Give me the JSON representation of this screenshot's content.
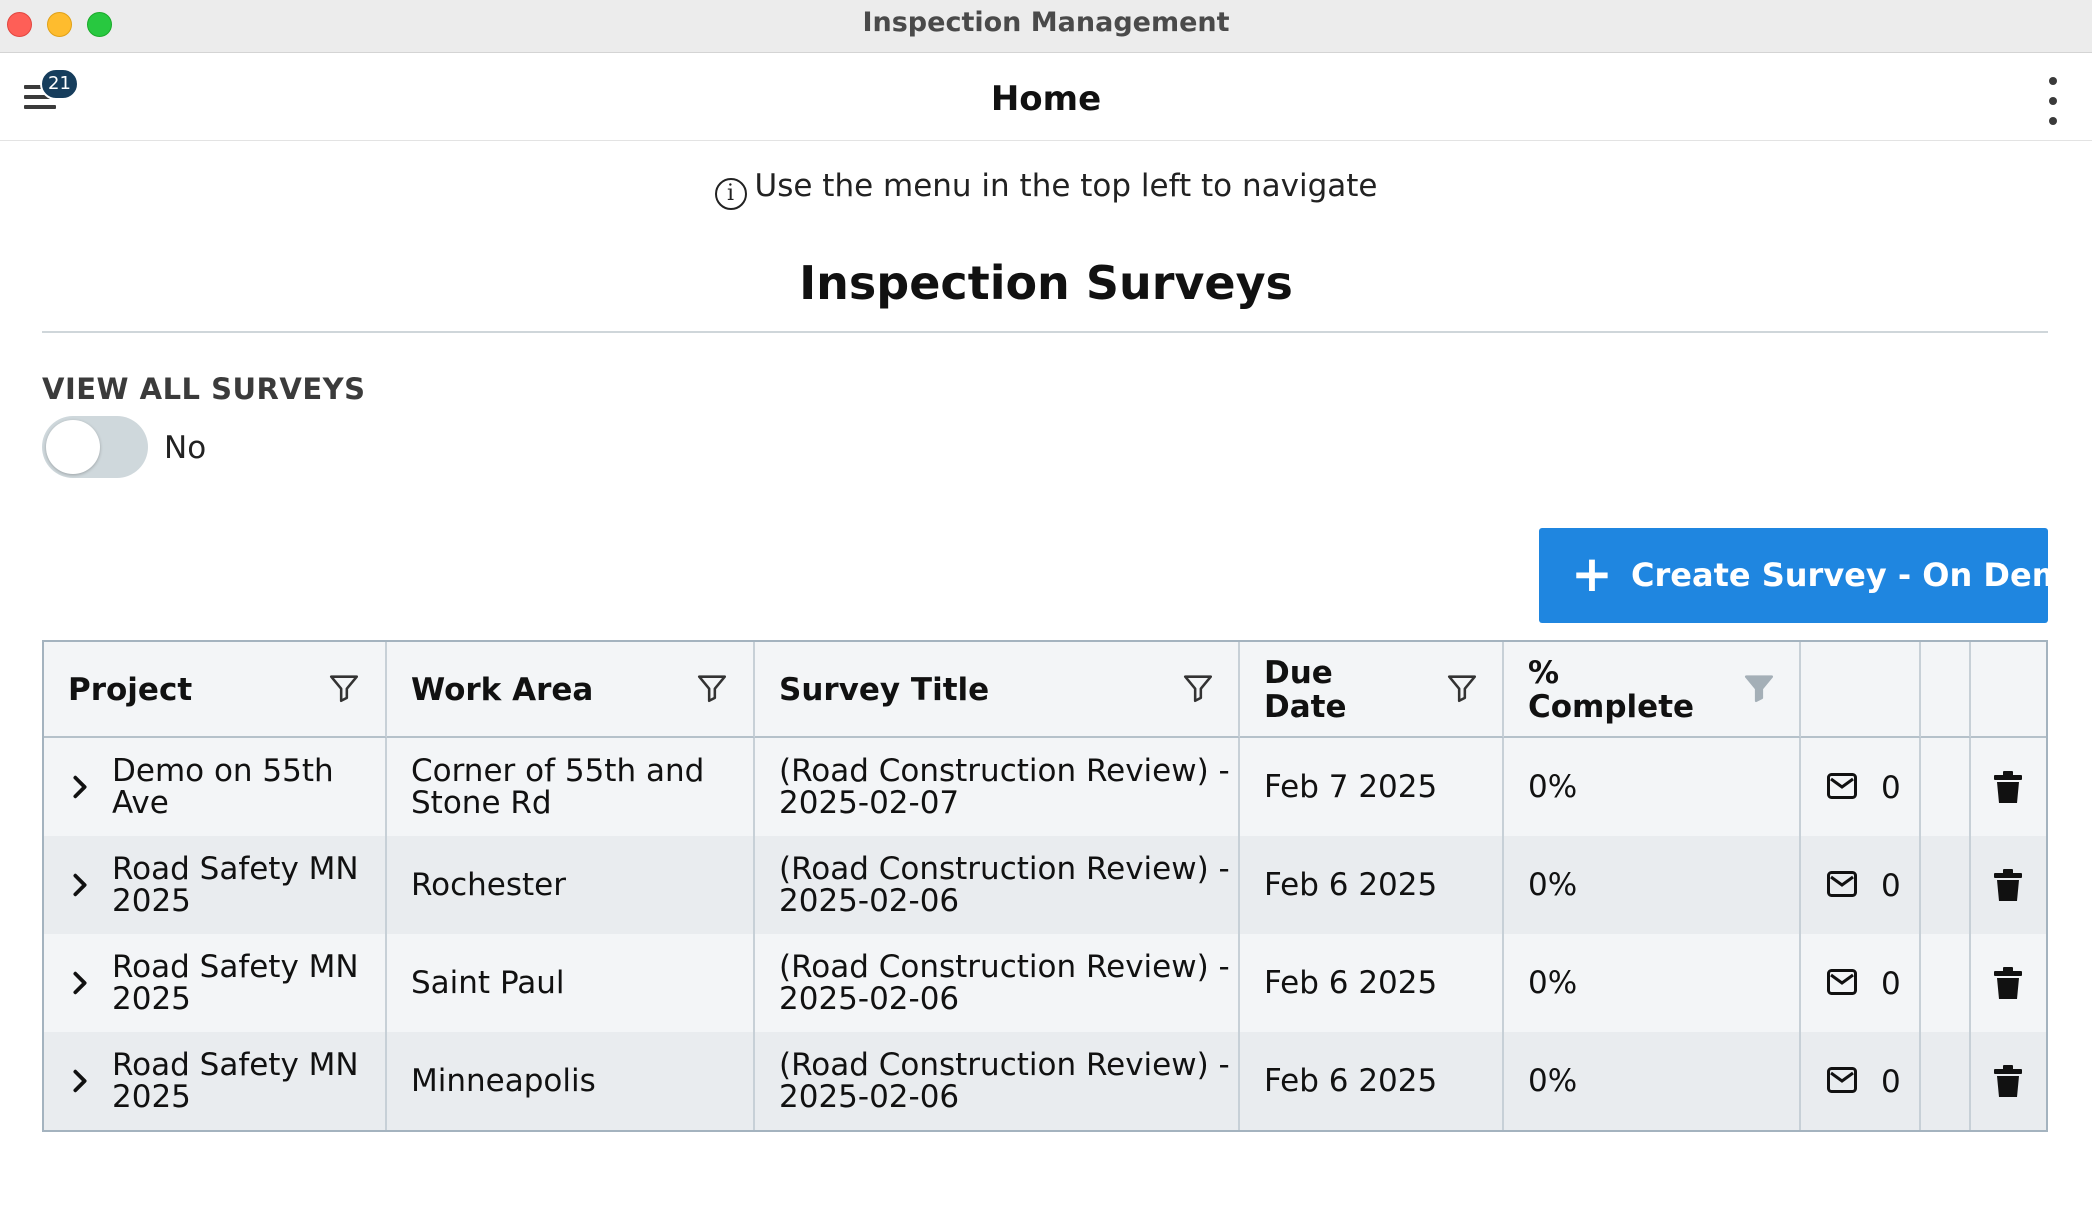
{
  "window": {
    "title": "Inspection Management"
  },
  "appbar": {
    "title": "Home",
    "menu_badge": "21"
  },
  "info": {
    "icon": "info-circle-icon",
    "text": "Use the menu in the top left to navigate"
  },
  "section": {
    "title": "Inspection Surveys"
  },
  "view_all": {
    "label": "VIEW ALL SURVEYS",
    "state_text": "No",
    "enabled": false
  },
  "create_button": {
    "label": "Create Survey - On Demand",
    "color": "#1f86e0"
  },
  "table": {
    "headers": {
      "project": "Project",
      "work_area": "Work Area",
      "survey_title_1": "Survey Title",
      "due_1": "Due",
      "due_2": "Date",
      "complete_1": "%",
      "complete_2": "Complete"
    },
    "rows": [
      {
        "project_1": "Demo on 55th",
        "project_2": "Ave",
        "work_area_1": "Corner of 55th and",
        "work_area_2": "Stone Rd",
        "title_1": "(Road Construction Review) -",
        "title_2": "2025-02-07",
        "due": "Feb 7 2025",
        "complete": "0%",
        "messages": "0"
      },
      {
        "project_1": "Road Safety MN",
        "project_2": "2025",
        "work_area_1": "Rochester",
        "work_area_2": "",
        "title_1": "(Road Construction Review) -",
        "title_2": "2025-02-06",
        "due": "Feb 6 2025",
        "complete": "0%",
        "messages": "0"
      },
      {
        "project_1": "Road Safety MN",
        "project_2": "2025",
        "work_area_1": "Saint Paul",
        "work_area_2": "",
        "title_1": "(Road Construction Review) -",
        "title_2": "2025-02-06",
        "due": "Feb 6 2025",
        "complete": "0%",
        "messages": "0"
      },
      {
        "project_1": "Road Safety MN",
        "project_2": "2025",
        "work_area_1": "Minneapolis",
        "work_area_2": "",
        "title_1": "(Road Construction Review) -",
        "title_2": "2025-02-06",
        "due": "Feb 6 2025",
        "complete": "0%",
        "messages": "0"
      }
    ]
  }
}
